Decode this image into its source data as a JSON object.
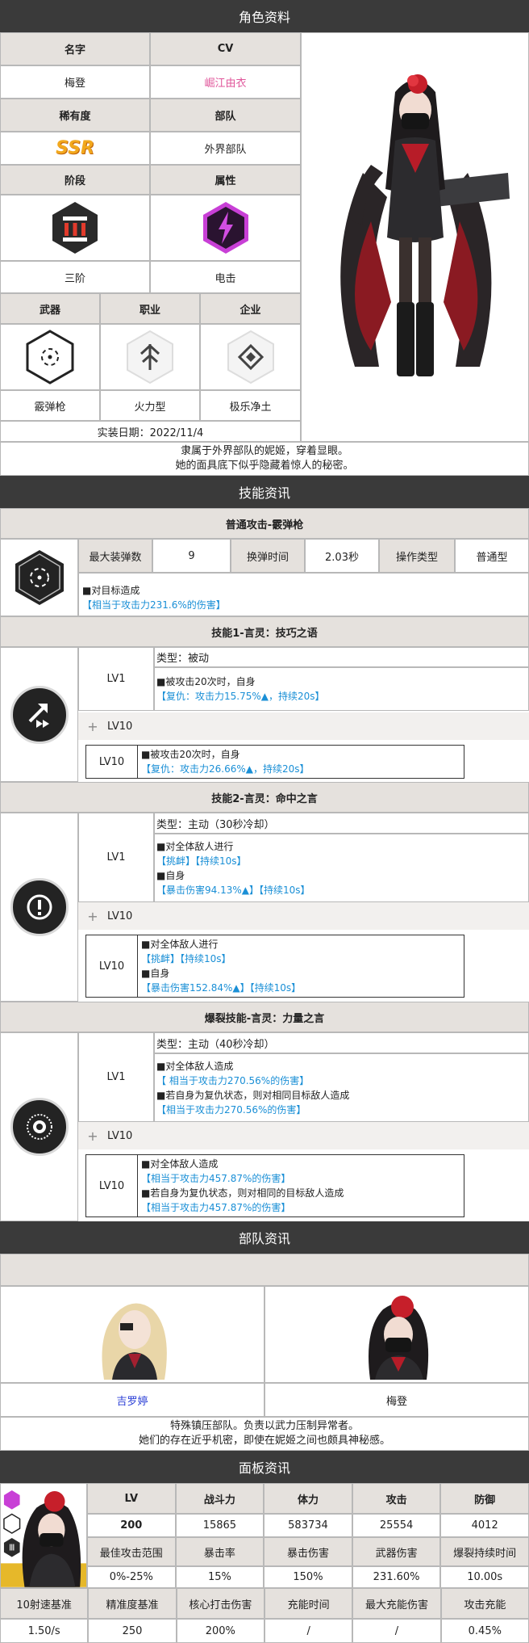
{
  "profile": {
    "section_title": "角色资料",
    "name_label": "名字",
    "cv_label": "CV",
    "name": "梅登",
    "cv": "崛江由衣",
    "rarity_label": "稀有度",
    "squad_label": "部队",
    "rarity": "SSR",
    "squad": "外界部队",
    "stage_label": "阶段",
    "attribute_label": "属性",
    "stage": "三阶",
    "attribute": "电击",
    "weapon_label": "武器",
    "class_label": "职业",
    "company_label": "企业",
    "weapon": "霰弹枪",
    "class": "火力型",
    "company": "极乐净土",
    "release": "实装日期：2022/11/4",
    "description_line1": "隶属于外界部队的妮姬，穿着显眼。",
    "description_line2": "她的面具底下似乎隐藏着惊人的秘密。",
    "stage_numeral": "Ⅲ"
  },
  "skills": {
    "section_title": "技能资讯",
    "normal": {
      "title": "普通攻击-霰弹枪",
      "ammo_label": "最大装弹数",
      "ammo": "9",
      "reload_label": "换弹时间",
      "reload": "2.03秒",
      "op_label": "操作类型",
      "op": "普通型",
      "line1": "■对目标造成",
      "line2": "【相当于攻击力231.6%的伤害】"
    },
    "skill1": {
      "title": "技能1-言灵：技巧之语",
      "lv1": "LV1",
      "type": "类型：被动",
      "lv1_line1": "■被攻击20次时，自身",
      "lv1_line2": "【复仇：攻击力15.75%▲，持续20s】",
      "lv10_toggle": "LV10",
      "lv10": "LV10",
      "lv10_line1": "■被攻击20次时，自身",
      "lv10_line2": "【复仇：攻击力26.66%▲，持续20s】"
    },
    "skill2": {
      "title": "技能2-言灵：命中之言",
      "lv1": "LV1",
      "type": "类型：主动（30秒冷却）",
      "lv1_line1": "■对全体敌人进行",
      "lv1_line2": "【挑衅】【持续10s】",
      "lv1_line3": "■自身",
      "lv1_line4": "【暴击伤害94.13%▲】【持续10s】",
      "lv10_toggle": "LV10",
      "lv10": "LV10",
      "lv10_line1": "■对全体敌人进行",
      "lv10_line2": "【挑衅】【持续10s】",
      "lv10_line3": "■自身",
      "lv10_line4": "【暴击伤害152.84%▲】【持续10s】"
    },
    "burst": {
      "title": "爆裂技能-言灵：力量之言",
      "lv1": "LV1",
      "type": "类型：主动（40秒冷却）",
      "lv1_line1": "■对全体敌人造成",
      "lv1_line2": "【 相当于攻击力270.56%的伤害】",
      "lv1_line3": "■若自身为复仇状态，则对相同目标敌人造成",
      "lv1_line4": "【相当于攻击力270.56%的伤害】",
      "lv10_toggle": "LV10",
      "lv10": "LV10",
      "lv10_line1": "■对全体敌人造成",
      "lv10_line2": "【相当于攻击力457.87%的伤害】",
      "lv10_line3": "■若自身为复仇状态，则对相同的目标敌人造成",
      "lv10_line4": "【相当于攻击力457.87%的伤害】"
    }
  },
  "squad": {
    "section_title": "部队资讯",
    "member1": "吉罗婷",
    "member2": "梅登",
    "desc_line1": "特殊镇压部队。负责以武力压制异常者。",
    "desc_line2": "她们的存在近乎机密，即使在妮姬之间也颇具神秘感。"
  },
  "panel": {
    "section_title": "面板资讯",
    "headers1": [
      "LV",
      "战斗力",
      "体力",
      "攻击",
      "防御"
    ],
    "values1": [
      "200",
      "15865",
      "583734",
      "25554",
      "4012"
    ],
    "headers2": [
      "最佳攻击范围",
      "暴击率",
      "暴击伤害",
      "武器伤害",
      "爆裂持续时间"
    ],
    "values2": [
      "0%-25%",
      "15%",
      "150%",
      "231.60%",
      "10.00s"
    ],
    "headers3": [
      "10射速基准",
      "精准度基准",
      "核心打击伤害",
      "充能时间",
      "最大充能伤害",
      "攻击充能"
    ],
    "values3": [
      "1.50/s",
      "250",
      "200%",
      "/",
      "/",
      "0.45%"
    ]
  },
  "colors": {
    "bar": "#3a3a3a",
    "header": "#e5e1dd",
    "blue": "#1a8fd6",
    "pink": "#e0559a",
    "ssr": "#f2a81d",
    "electric": "#c83fd6"
  }
}
